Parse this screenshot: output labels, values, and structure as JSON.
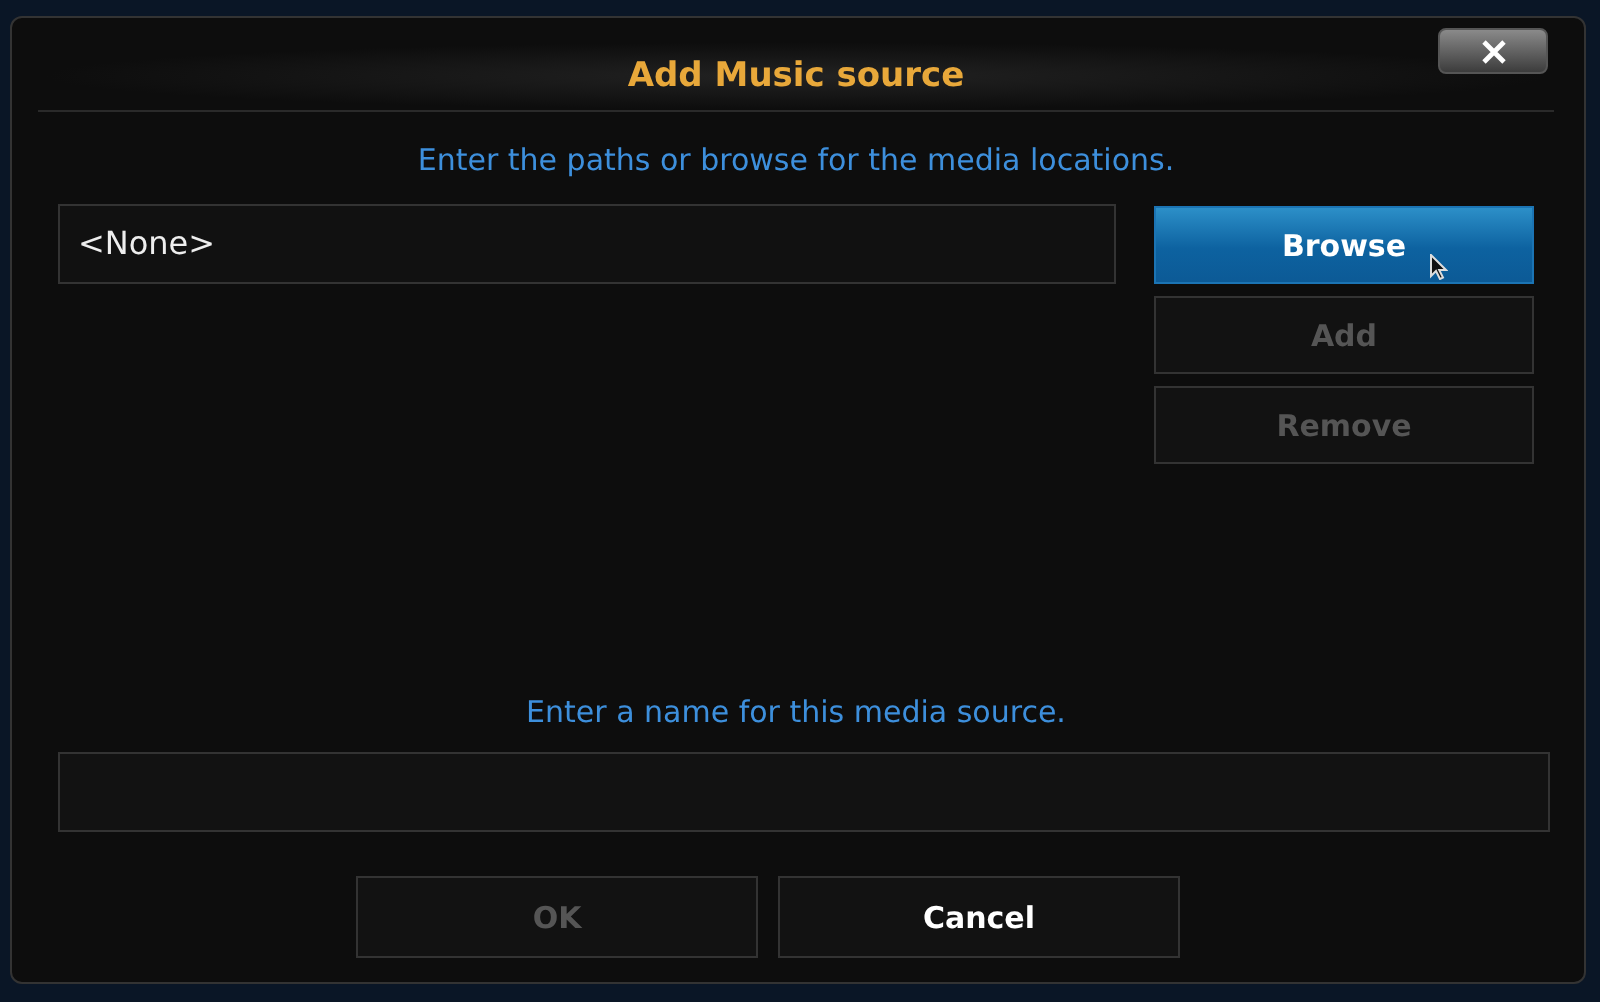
{
  "dialog": {
    "title": "Add Music source",
    "paths_prompt": "Enter the paths or browse for the media locations.",
    "paths": [
      {
        "text": "<None>"
      }
    ],
    "path_buttons": [
      {
        "label": "Browse",
        "focused": true,
        "disabled": false
      },
      {
        "label": "Add",
        "focused": false,
        "disabled": true
      },
      {
        "label": "Remove",
        "focused": false,
        "disabled": true
      }
    ],
    "name_prompt": "Enter a name for this media source.",
    "buttons": [
      {
        "label": "OK",
        "focused": false,
        "disabled": true
      },
      {
        "label": "Cancel",
        "focused": false,
        "disabled": false
      }
    ]
  }
}
